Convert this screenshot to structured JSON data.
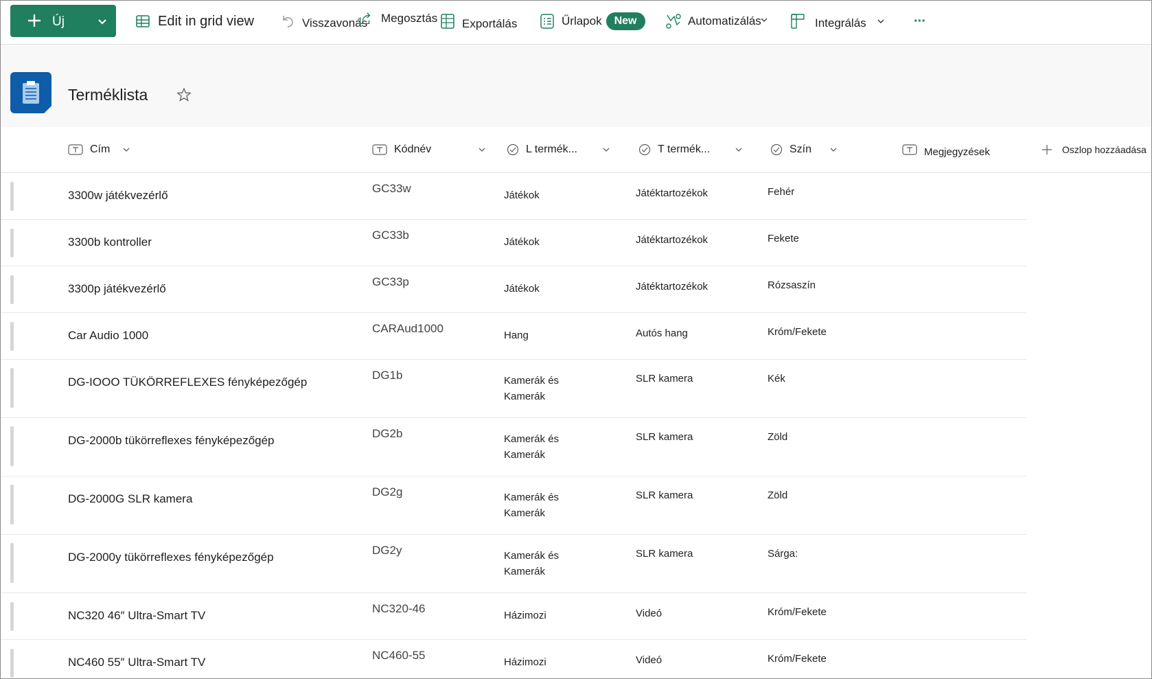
{
  "toolbar": {
    "new_label": "Új",
    "edit_grid": "Edit in grid view",
    "undo": "Visszavonás",
    "share": "Megosztás",
    "export": "Exportálás",
    "forms": "Űrlapok",
    "forms_badge": "New",
    "automate": "Automatizálás",
    "integrate": "Integrálás",
    "more": "···"
  },
  "list": {
    "title": "Terméklista"
  },
  "columns": {
    "title": "Cím",
    "code": "Kódnév",
    "l_product": "L termék...",
    "t_product": "T termék...",
    "color": "Szín",
    "notes": "Megjegyzések",
    "add_column": "Oszlop hozzáadása"
  },
  "rows": [
    {
      "title": "3300w játékvezérlő",
      "code": "GC33w",
      "l": "Játékok",
      "t": "Játéktartozékok",
      "color": "Fehér"
    },
    {
      "title": "3300b kontroller",
      "code": "GC33b",
      "l": "Játékok",
      "t": "Játéktartozékok",
      "color": "Fekete"
    },
    {
      "title": "3300p játékvezérlő",
      "code": "GC33p",
      "l": "Játékok",
      "t": "Játéktartozékok",
      "color": "Rózsaszín"
    },
    {
      "title": "Car Audio 1000",
      "code": "CARAud1000",
      "l": "Hang",
      "t": "Autós hang",
      "color": "Króm/Fekete"
    },
    {
      "title": "DG-IOOO TÜKÖRREFLEXES fényképezőgép",
      "code": "DG1b",
      "l": "Kamerák és Kamerák",
      "t": "SLR kamera",
      "color": "Kék"
    },
    {
      "title": "DG-2000b tükörreflexes fényképezőgép",
      "code": "DG2b",
      "l": "Kamerák és Kamerák",
      "t": "SLR kamera",
      "color": "Zöld"
    },
    {
      "title": "DG-2000G SLR kamera",
      "code": "DG2g",
      "l": "Kamerák és Kamerák",
      "t": "SLR kamera",
      "color": "Zöld"
    },
    {
      "title": "DG-2000y tükörreflexes fényképezőgép",
      "code": "DG2y",
      "l": "Kamerák és Kamerák",
      "t": "SLR kamera",
      "color": "Sárga:"
    },
    {
      "title": "NC320 46″ Ultra-Smart TV",
      "code": "NC320-46",
      "l": "Házimozi",
      "t": "Videó",
      "color": "Króm/Fekete"
    },
    {
      "title": "NC460 55″ Ultra-Smart TV",
      "code": "NC460-55",
      "l": "Házimozi",
      "t": "Videó",
      "color": "Króm/Fekete"
    }
  ]
}
